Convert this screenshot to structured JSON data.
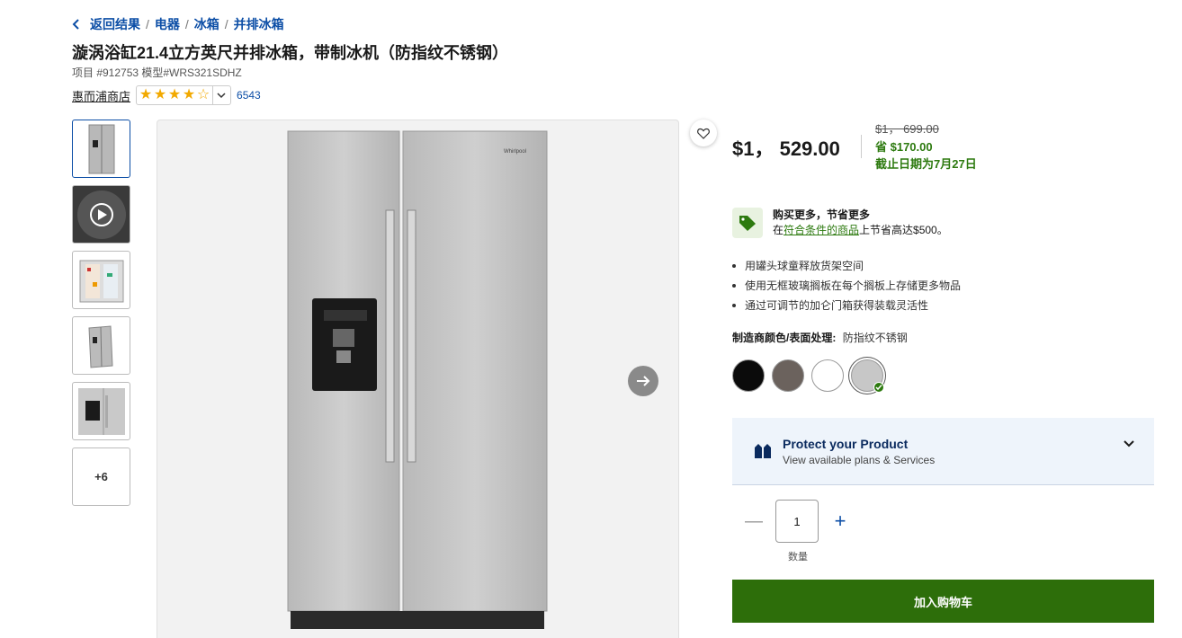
{
  "breadcrumb": {
    "back": "返回结果",
    "items": [
      "电器",
      "冰箱",
      "并排冰箱"
    ]
  },
  "product": {
    "title": "漩涡浴缸21.4立方英尺并排冰箱，带制冰机（防指纹不锈钢）",
    "meta": "项目 #912753 模型#WRS321SDHZ",
    "brand": "惠而浦商店",
    "rating": 4.5,
    "review_count": "6543"
  },
  "thumbnails": {
    "more_label": "+6"
  },
  "pricing": {
    "price": "$1， 529.00",
    "was": "$1， 699.00",
    "save": "省 $170.00",
    "ends": "截止日期为7月27日"
  },
  "promo": {
    "title": "购买更多，节省更多",
    "prefix": "在",
    "link": "符合条件的商品",
    "suffix": "上节省高达$500。"
  },
  "bullets": [
    "用罐头球童释放货架空间",
    "使用无框玻璃搁板在每个搁板上存储更多物品",
    "通过可调节的加仑门箱获得装载灵活性"
  ],
  "color": {
    "label": "制造商颜色/表面处理:",
    "value": "防指纹不锈钢",
    "swatches": [
      "#0b0b0b",
      "#6b625d",
      "#ffffff",
      "#c7c7c7"
    ]
  },
  "protect": {
    "title": "Protect your Product",
    "subtitle": "View available plans & Services"
  },
  "quantity": {
    "value": "1",
    "label": "数量",
    "minus": "—",
    "plus": "+"
  },
  "cart": {
    "label": "加入购物车"
  },
  "brand_colors": {
    "link": "#0c4ea6",
    "green": "#2d6e0a",
    "star": "#f2a900"
  }
}
